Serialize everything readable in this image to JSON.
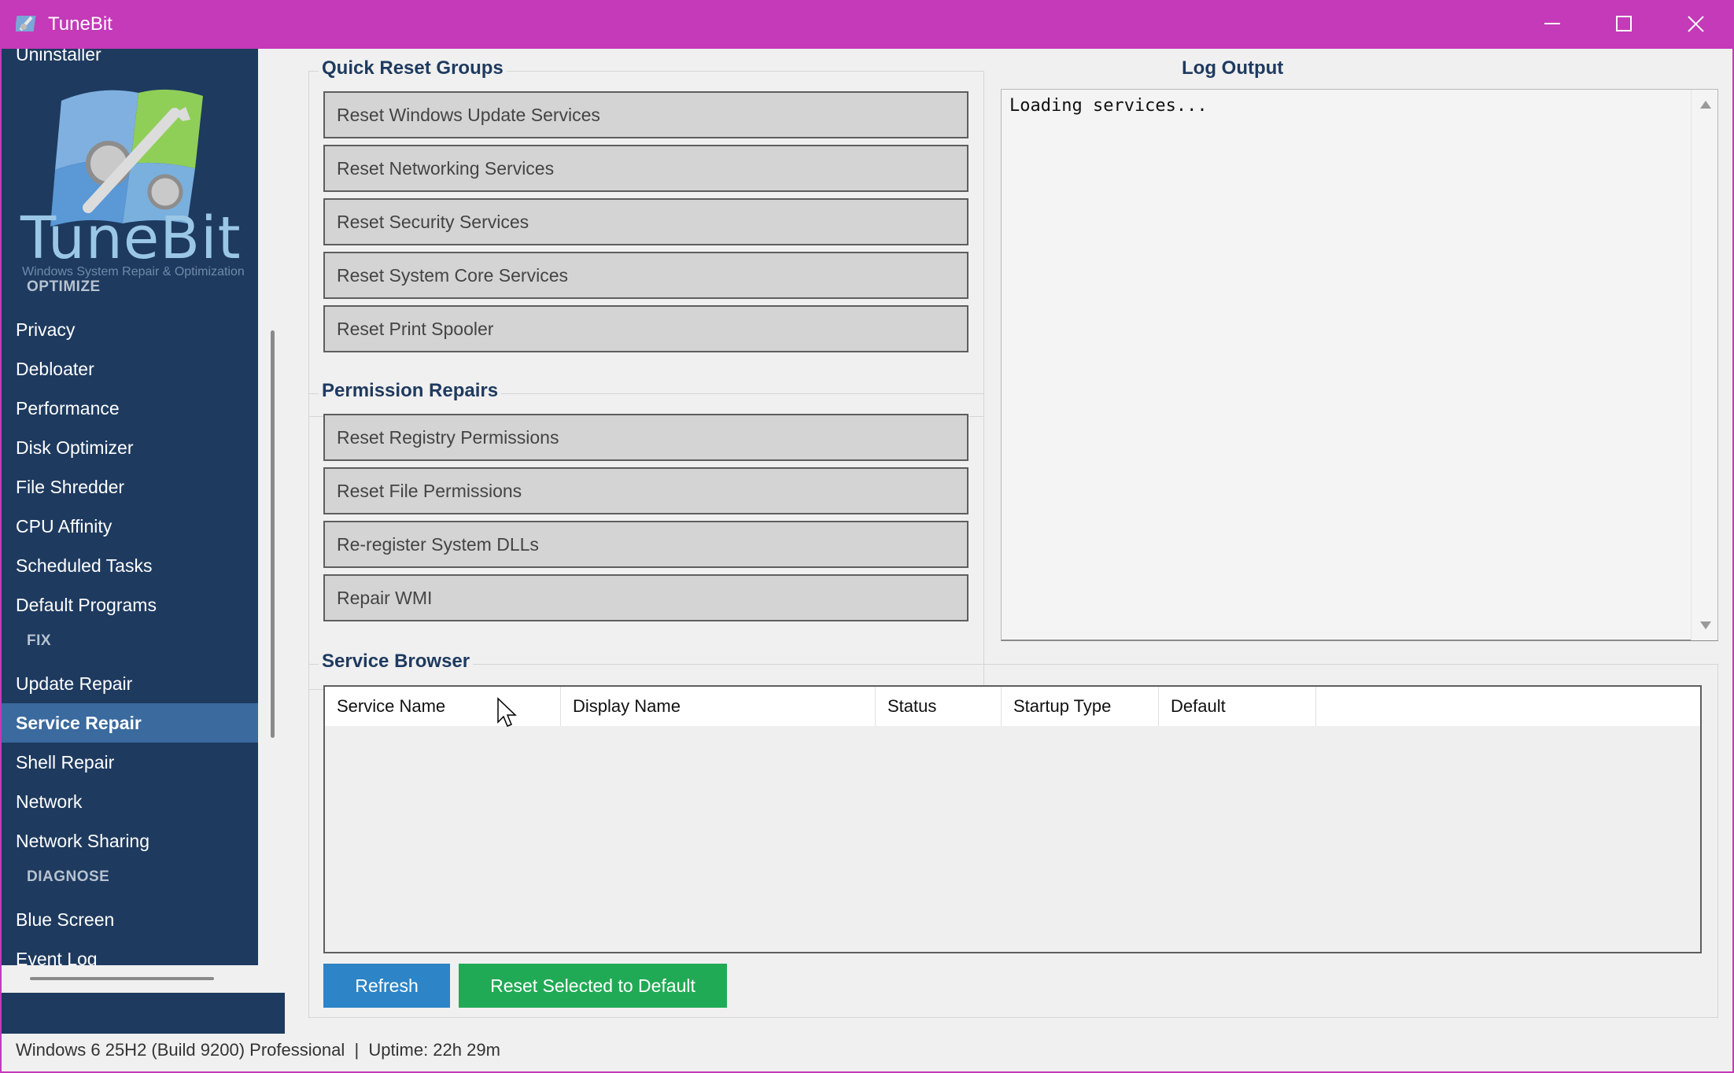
{
  "window": {
    "title": "TuneBit"
  },
  "sidebar": {
    "clipped_item": "Uninstaller",
    "logo_text": "TuneBit",
    "logo_tagline": "Windows System Repair & Optimization",
    "sections": [
      {
        "label": "OPTIMIZE",
        "items": [
          "Privacy",
          "Debloater",
          "Performance",
          "Disk Optimizer",
          "File Shredder",
          "CPU Affinity",
          "Scheduled Tasks",
          "Default Programs"
        ]
      },
      {
        "label": "FIX",
        "items": [
          "Update Repair",
          "Service Repair",
          "Shell Repair",
          "Network",
          "Network Sharing"
        ]
      },
      {
        "label": "DIAGNOSE",
        "items": [
          "Blue Screen",
          "Event Log"
        ]
      }
    ],
    "active_item": "Service Repair"
  },
  "quick_reset": {
    "title": "Quick Reset Groups",
    "buttons": [
      "Reset Windows Update Services",
      "Reset Networking Services",
      "Reset Security Services",
      "Reset System Core Services",
      "Reset Print Spooler"
    ]
  },
  "permission_repairs": {
    "title": "Permission Repairs",
    "buttons": [
      "Reset Registry Permissions",
      "Reset File Permissions",
      "Re-register System DLLs",
      "Repair WMI"
    ]
  },
  "log": {
    "title": "Log Output",
    "text": "Loading services..."
  },
  "service_browser": {
    "title": "Service Browser",
    "columns": [
      "Service Name",
      "Display Name",
      "Status",
      "Startup Type",
      "Default"
    ],
    "rows": [],
    "refresh_label": "Refresh",
    "reset_label": "Reset Selected to Default",
    "refresh_color": "#2d84c6",
    "reset_color": "#21aa55"
  },
  "status_bar": {
    "text": "Windows 6 25H2 (Build 9200) Professional  |  Uptime: 22h 29m"
  },
  "colors": {
    "titlebar": "#c43ab8",
    "sidebar": "#1e3a5f",
    "active_item": "#3a6a9e"
  }
}
